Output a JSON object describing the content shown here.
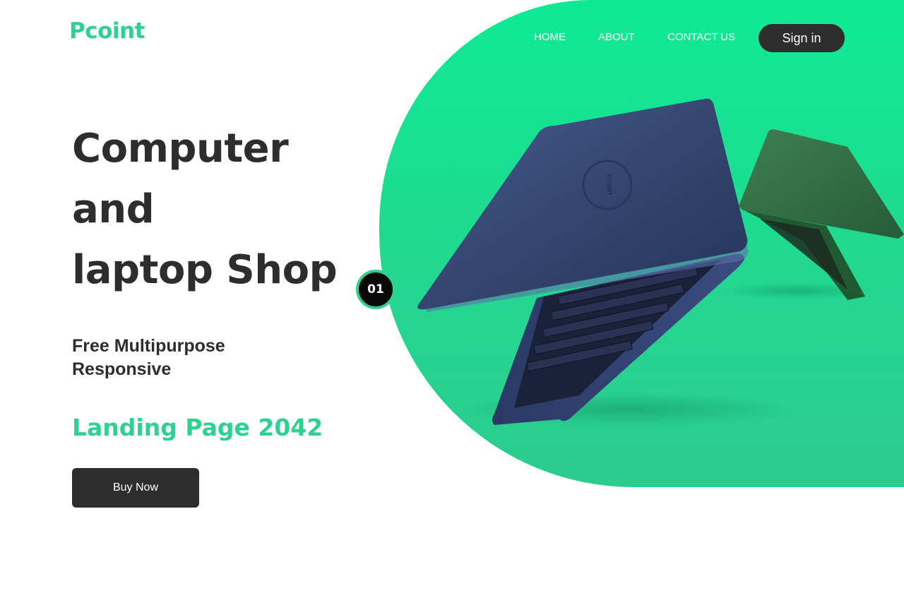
{
  "brand": {
    "logo_text": "Pcoint"
  },
  "nav": {
    "links": [
      {
        "label": "HOME"
      },
      {
        "label": "ABOUT"
      },
      {
        "label": "CONTACT US"
      }
    ],
    "signin_label": "Sign in"
  },
  "hero": {
    "headline_lines": [
      "Computer",
      "and",
      "laptop Shop"
    ],
    "subhead_lines": [
      "Free Multipurpose",
      "Responsive"
    ],
    "tagline": "Landing Page 2042",
    "cta_label": "Buy Now",
    "slide_number": "01",
    "laptop_logo_text": "PCOINT"
  },
  "colors": {
    "accent": "#2fd191",
    "hero_gradient_top": "#0eea94",
    "hero_gradient_bottom": "#2dcb8f",
    "dark": "#2d2d2d",
    "laptop_blue": "#34456f",
    "laptop_green": "#2f6a40"
  }
}
